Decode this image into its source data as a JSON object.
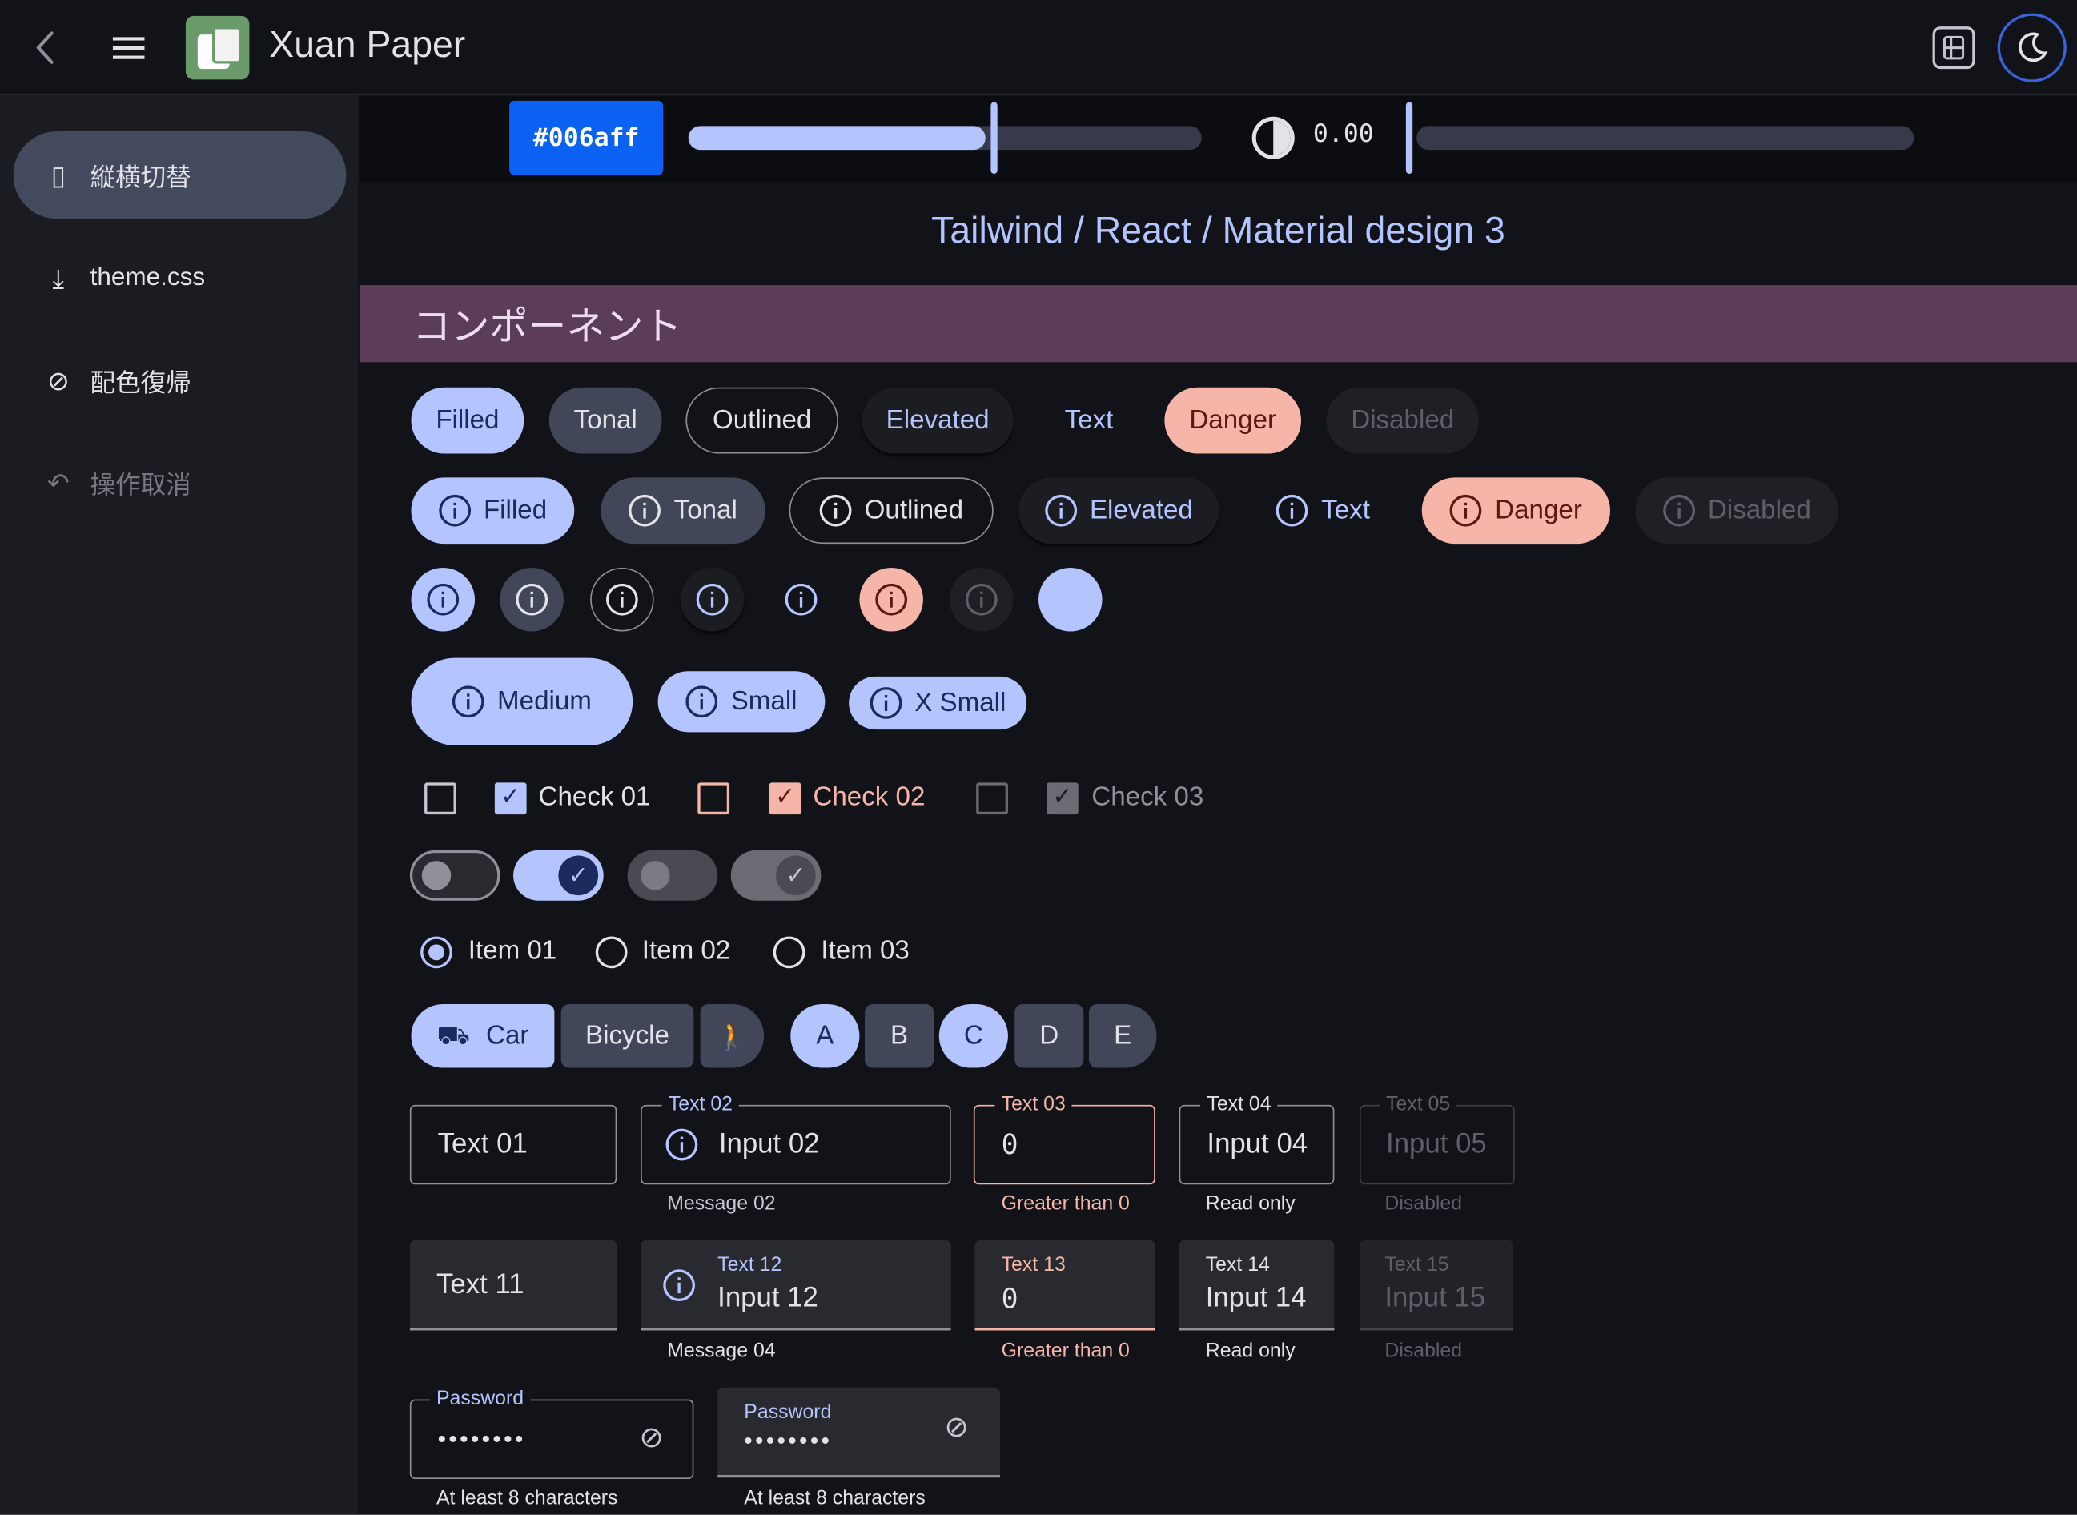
{
  "app": {
    "title": "Xuan Paper",
    "back_icon": "chevron-left-icon",
    "menu_icon": "hamburger-icon",
    "logo_icon": "paper-logo-icon"
  },
  "topbar": {
    "layout_icon": "split-layout-icon",
    "theme_icon": "moon-icon"
  },
  "sidebar": {
    "items": [
      {
        "label": "縦横切替",
        "icon": "rotate-device-icon",
        "active": true
      },
      {
        "label": "theme.css",
        "icon": "download-icon"
      },
      {
        "label": "配色復帰",
        "icon": "reset-palette-icon"
      },
      {
        "label": "操作取消",
        "icon": "undo-icon",
        "disabled": true
      }
    ]
  },
  "controls": {
    "color_hex": "#006aff",
    "hue_fraction": 0.59,
    "contrast_value": "0.00",
    "contrast_fraction": 0.0
  },
  "page": {
    "subtitle": "Tailwind / React / Material design 3",
    "section_title": "コンポーネント"
  },
  "buttons": {
    "row1": [
      "Filled",
      "Tonal",
      "Outlined",
      "Elevated",
      "Text",
      "Danger",
      "Disabled"
    ],
    "row2": [
      "Filled",
      "Tonal",
      "Outlined",
      "Elevated",
      "Text",
      "Danger",
      "Disabled"
    ],
    "sizes": [
      "Medium",
      "Small",
      "X Small"
    ]
  },
  "checks": {
    "items": [
      {
        "label": "Check 01",
        "variant": "primary"
      },
      {
        "label": "Check 02",
        "variant": "danger"
      },
      {
        "label": "Check 03",
        "variant": "disabled"
      }
    ]
  },
  "radios": {
    "items": [
      "Item 01",
      "Item 02",
      "Item 03"
    ],
    "selected": 0
  },
  "segments": {
    "transport": [
      "Car",
      "Bicycle"
    ],
    "letters": [
      "A",
      "B",
      "C",
      "D",
      "E"
    ],
    "letters_selected": [
      "A",
      "C"
    ]
  },
  "fields": {
    "outlined": [
      {
        "value": "Text 01"
      },
      {
        "label": "Text 02",
        "value": "Input 02",
        "message": "Message 02"
      },
      {
        "label": "Text 03",
        "value": "0",
        "message": "Greater than 0"
      },
      {
        "label": "Text 04",
        "value": "Input 04",
        "message": "Read only"
      },
      {
        "label": "Text 05",
        "value": "Input 05",
        "message": "Disabled"
      }
    ],
    "filled": [
      {
        "value": "Text 11"
      },
      {
        "label": "Text 12",
        "value": "Input 12",
        "message": "Message 04"
      },
      {
        "label": "Text 13",
        "value": "0",
        "message": "Greater than 0"
      },
      {
        "label": "Text 14",
        "value": "Input 14",
        "message": "Read only"
      },
      {
        "label": "Text 15",
        "value": "Input 15",
        "message": "Disabled"
      }
    ],
    "password": [
      {
        "label": "Password",
        "value": "••••••••",
        "message": "At least 8 characters"
      },
      {
        "label": "Password",
        "value": "••••••••",
        "message": "At least 8 characters"
      }
    ]
  },
  "colors": {
    "primary": "#b4c4ff",
    "danger": "#f5b5a8",
    "chip": "#0a61f2",
    "section_bg": "#5b3d59",
    "background": "#121318"
  }
}
